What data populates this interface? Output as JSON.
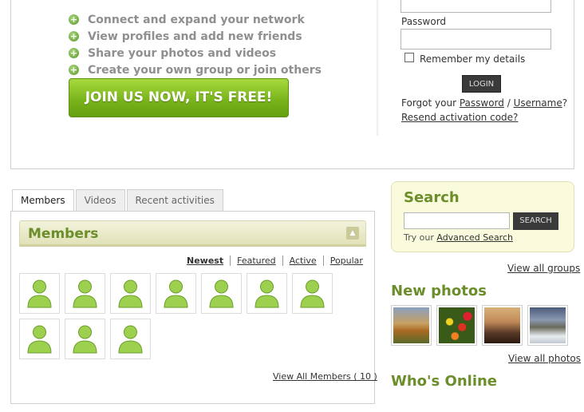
{
  "features": [
    "Connect and expand your network",
    "View profiles and add new friends",
    "Share your photos and videos",
    "Create your own group or join others"
  ],
  "join_button": "JOIN US NOW, IT'S FREE!",
  "login": {
    "password_label": "Password",
    "remember_label": "Remember my details",
    "login_button": "LOGIN",
    "forgot_prefix": "Forgot your ",
    "forgot_password": "Password",
    "forgot_sep": " / ",
    "forgot_username": "Username",
    "forgot_suffix": "?",
    "resend": "Resend activation code?"
  },
  "tabs": [
    {
      "label": "Members",
      "active": true
    },
    {
      "label": "Videos",
      "active": false
    },
    {
      "label": "Recent activities",
      "active": false
    }
  ],
  "members": {
    "title": "Members",
    "filters": [
      "Newest",
      "Featured",
      "Active",
      "Popular"
    ],
    "active_filter": "Newest",
    "avatar_count": 10,
    "view_all": "View All Members ( 10 )"
  },
  "search": {
    "title": "Search",
    "button": "SEARCH",
    "hint_prefix": "Try our ",
    "hint_link": "Advanced Search",
    "input_value": ""
  },
  "view_all_groups": "View all groups",
  "new_photos": {
    "title": "New photos",
    "photos": [
      "autumn-landscape",
      "flowers",
      "tree-sunset",
      "road-snow"
    ],
    "view_all": "View all photos"
  },
  "whos_online": {
    "title": "Who's Online"
  },
  "colors": {
    "accent_green": "#6b8e2a",
    "join_green": "#7ab51d",
    "dark_button": "#3a3a3a"
  }
}
